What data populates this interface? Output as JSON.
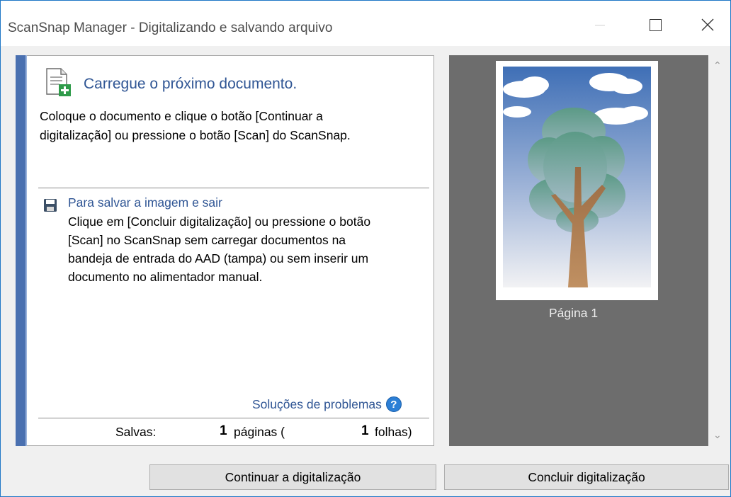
{
  "window": {
    "title": "ScanSnap Manager - Digitalizando e salvando arquivo"
  },
  "left_panel": {
    "heading": "Carregue o próximo documento.",
    "instruction_line1": "Coloque o documento e clique o botão [Continuar a",
    "instruction_line2": "digitalização] ou pressione o botão [Scan] do ScanSnap.",
    "save_section": {
      "title": "Para salvar a imagem e sair",
      "line1": "Clique em [Concluir digitalização] ou pressione o botão",
      "line2": "[Scan] no ScanSnap sem carregar documentos na",
      "line3": "bandeja de entrada do AAD (tampa) ou sem inserir um",
      "line4": "documento no alimentador manual."
    },
    "troubleshooting_link": "Soluções de problemas",
    "stats": {
      "saved_label": "Salvas:",
      "pages_count": "1",
      "pages_label": "páginas (",
      "sheets_count": "1",
      "sheets_label": "folhas)"
    }
  },
  "preview": {
    "page_label": "Página 1"
  },
  "buttons": {
    "continue_label": "Continuar a digitalização",
    "finish_label": "Concluir digitalização"
  },
  "icons": {
    "document": "document-add-icon",
    "save": "floppy-disk-icon",
    "help": "help-icon"
  },
  "colors": {
    "accent": "#4a70b0",
    "link": "#2f5594",
    "preview_bg": "#6d6d6d"
  }
}
